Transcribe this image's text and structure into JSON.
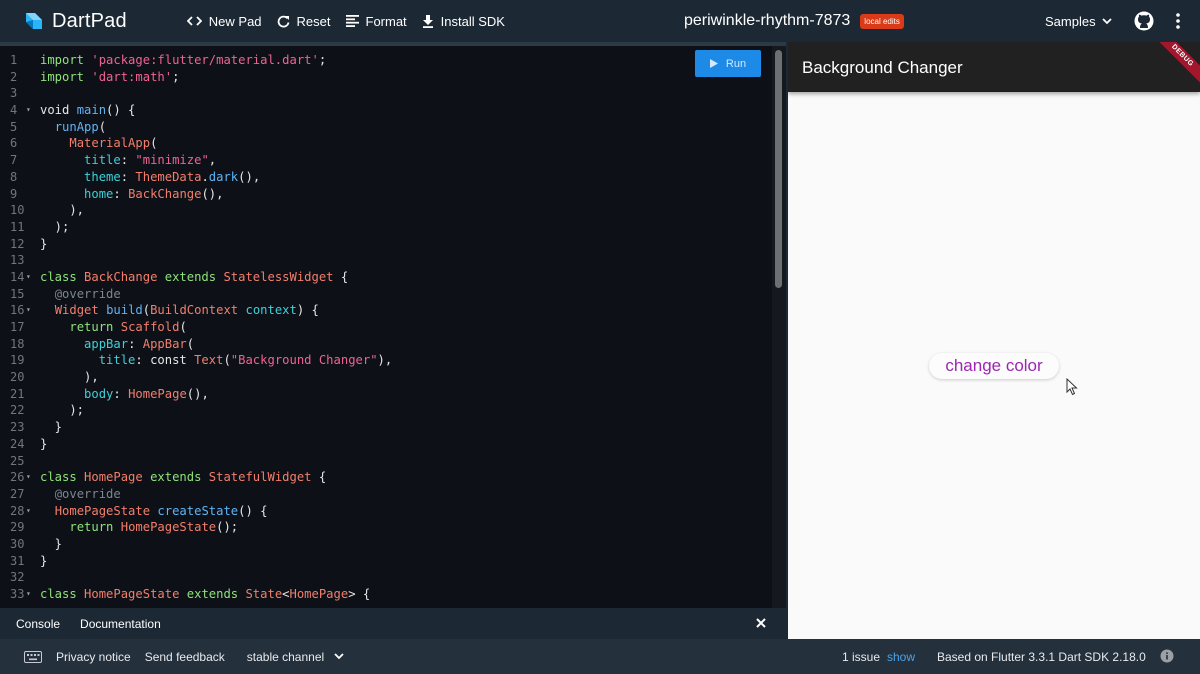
{
  "header": {
    "app_name": "DartPad",
    "toolbar": {
      "new_pad": "New Pad",
      "reset": "Reset",
      "format": "Format",
      "install_sdk": "Install SDK"
    },
    "project_name": "periwinkle-rhythm-7873",
    "badge": "local edits",
    "samples": "Samples"
  },
  "editor": {
    "run_label": "Run",
    "lines": [
      {
        "n": "1",
        "fold": false,
        "tokens": [
          [
            "k",
            "import "
          ],
          [
            "s",
            "'package:flutter/material.dart'"
          ],
          [
            "p",
            ";"
          ]
        ]
      },
      {
        "n": "2",
        "fold": false,
        "tokens": [
          [
            "k",
            "import "
          ],
          [
            "s",
            "'dart:math'"
          ],
          [
            "p",
            ";"
          ]
        ]
      },
      {
        "n": "3",
        "fold": false,
        "tokens": []
      },
      {
        "n": "4",
        "fold": true,
        "tokens": [
          [
            "p",
            "void "
          ],
          [
            "f",
            "main"
          ],
          [
            "p",
            "() {"
          ]
        ]
      },
      {
        "n": "5",
        "fold": false,
        "tokens": [
          [
            "p",
            "  "
          ],
          [
            "f",
            "runApp"
          ],
          [
            "p",
            "("
          ]
        ]
      },
      {
        "n": "6",
        "fold": false,
        "tokens": [
          [
            "p",
            "    "
          ],
          [
            "t",
            "MaterialApp"
          ],
          [
            "p",
            "("
          ]
        ]
      },
      {
        "n": "7",
        "fold": false,
        "tokens": [
          [
            "p",
            "      "
          ],
          [
            "pr",
            "title"
          ],
          [
            "p",
            ": "
          ],
          [
            "s",
            "\"minimize\""
          ],
          [
            "p",
            ","
          ]
        ]
      },
      {
        "n": "8",
        "fold": false,
        "tokens": [
          [
            "p",
            "      "
          ],
          [
            "pr",
            "theme"
          ],
          [
            "p",
            ": "
          ],
          [
            "t",
            "ThemeData"
          ],
          [
            "p",
            "."
          ],
          [
            "f",
            "dark"
          ],
          [
            "p",
            "(),"
          ]
        ]
      },
      {
        "n": "9",
        "fold": false,
        "tokens": [
          [
            "p",
            "      "
          ],
          [
            "pr",
            "home"
          ],
          [
            "p",
            ": "
          ],
          [
            "t",
            "BackChange"
          ],
          [
            "p",
            "(),"
          ]
        ]
      },
      {
        "n": "10",
        "fold": false,
        "tokens": [
          [
            "p",
            "    ),"
          ]
        ]
      },
      {
        "n": "11",
        "fold": false,
        "tokens": [
          [
            "p",
            "  );"
          ]
        ]
      },
      {
        "n": "12",
        "fold": false,
        "tokens": [
          [
            "p",
            "}"
          ]
        ]
      },
      {
        "n": "13",
        "fold": false,
        "tokens": []
      },
      {
        "n": "14",
        "fold": true,
        "tokens": [
          [
            "k",
            "class "
          ],
          [
            "t",
            "BackChange "
          ],
          [
            "k",
            "extends "
          ],
          [
            "t",
            "StatelessWidget"
          ],
          [
            "p",
            " {"
          ]
        ]
      },
      {
        "n": "15",
        "fold": false,
        "tokens": [
          [
            "p",
            "  "
          ],
          [
            "a",
            "@override"
          ]
        ]
      },
      {
        "n": "16",
        "fold": true,
        "tokens": [
          [
            "p",
            "  "
          ],
          [
            "t",
            "Widget "
          ],
          [
            "f",
            "build"
          ],
          [
            "p",
            "("
          ],
          [
            "t",
            "BuildContext "
          ],
          [
            "pr",
            "context"
          ],
          [
            "p",
            ") {"
          ]
        ]
      },
      {
        "n": "17",
        "fold": false,
        "tokens": [
          [
            "p",
            "    "
          ],
          [
            "k",
            "return "
          ],
          [
            "t",
            "Scaffold"
          ],
          [
            "p",
            "("
          ]
        ]
      },
      {
        "n": "18",
        "fold": false,
        "tokens": [
          [
            "p",
            "      "
          ],
          [
            "pr",
            "appBar"
          ],
          [
            "p",
            ": "
          ],
          [
            "t",
            "AppBar"
          ],
          [
            "p",
            "("
          ]
        ]
      },
      {
        "n": "19",
        "fold": false,
        "tokens": [
          [
            "p",
            "        "
          ],
          [
            "pr",
            "title"
          ],
          [
            "p",
            ": const "
          ],
          [
            "t",
            "Text"
          ],
          [
            "p",
            "("
          ],
          [
            "s",
            "\"Background Changer\""
          ],
          [
            "p",
            "),"
          ]
        ]
      },
      {
        "n": "20",
        "fold": false,
        "tokens": [
          [
            "p",
            "      ),"
          ]
        ]
      },
      {
        "n": "21",
        "fold": false,
        "tokens": [
          [
            "p",
            "      "
          ],
          [
            "pr",
            "body"
          ],
          [
            "p",
            ": "
          ],
          [
            "t",
            "HomePage"
          ],
          [
            "p",
            "(),"
          ]
        ]
      },
      {
        "n": "22",
        "fold": false,
        "tokens": [
          [
            "p",
            "    );"
          ]
        ]
      },
      {
        "n": "23",
        "fold": false,
        "tokens": [
          [
            "p",
            "  }"
          ]
        ]
      },
      {
        "n": "24",
        "fold": false,
        "tokens": [
          [
            "p",
            "}"
          ]
        ]
      },
      {
        "n": "25",
        "fold": false,
        "tokens": []
      },
      {
        "n": "26",
        "fold": true,
        "tokens": [
          [
            "k",
            "class "
          ],
          [
            "t",
            "HomePage "
          ],
          [
            "k",
            "extends "
          ],
          [
            "t",
            "StatefulWidget"
          ],
          [
            "p",
            " {"
          ]
        ]
      },
      {
        "n": "27",
        "fold": false,
        "tokens": [
          [
            "p",
            "  "
          ],
          [
            "a",
            "@override"
          ]
        ]
      },
      {
        "n": "28",
        "fold": true,
        "tokens": [
          [
            "p",
            "  "
          ],
          [
            "t",
            "HomePageState "
          ],
          [
            "f",
            "createState"
          ],
          [
            "p",
            "() {"
          ]
        ]
      },
      {
        "n": "29",
        "fold": false,
        "tokens": [
          [
            "p",
            "    "
          ],
          [
            "k",
            "return "
          ],
          [
            "t",
            "HomePageState"
          ],
          [
            "p",
            "();"
          ]
        ]
      },
      {
        "n": "30",
        "fold": false,
        "tokens": [
          [
            "p",
            "  }"
          ]
        ]
      },
      {
        "n": "31",
        "fold": false,
        "tokens": [
          [
            "p",
            "}"
          ]
        ]
      },
      {
        "n": "32",
        "fold": false,
        "tokens": []
      },
      {
        "n": "33",
        "fold": true,
        "tokens": [
          [
            "k",
            "class "
          ],
          [
            "t",
            "HomePageState "
          ],
          [
            "k",
            "extends "
          ],
          [
            "t",
            "State"
          ],
          [
            "p",
            "<"
          ],
          [
            "t",
            "HomePage"
          ],
          [
            "p",
            "> {"
          ]
        ]
      }
    ]
  },
  "console_bar": {
    "console": "Console",
    "documentation": "Documentation"
  },
  "preview": {
    "appbar_title": "Background Changer",
    "debug_banner": "DEBUG",
    "button_label": "change color"
  },
  "footer": {
    "privacy": "Privacy notice",
    "feedback": "Send feedback",
    "channel": "stable channel",
    "issues": "1 issue",
    "show": "show",
    "sdk": "Based on Flutter 3.3.1 Dart SDK 2.18.0"
  },
  "colors": {
    "accent": "#1c8ae6",
    "badge": "#d93a17",
    "button_text": "#9c27b0"
  }
}
